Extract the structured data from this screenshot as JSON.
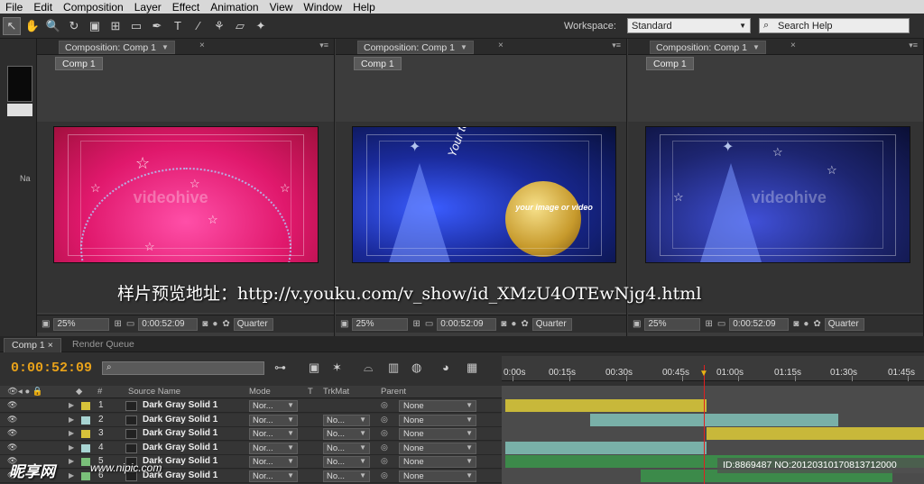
{
  "menu": [
    "File",
    "Edit",
    "Composition",
    "Layer",
    "Effect",
    "Animation",
    "View",
    "Window",
    "Help"
  ],
  "toolbar": {
    "workspace_label": "Workspace:",
    "workspace_value": "Standard",
    "search_help": "Search Help",
    "tools": [
      "selection-tool-icon",
      "hand-tool-icon",
      "zoom-tool-icon",
      "rotate-tool-icon",
      "camera-tool-icon",
      "pan-behind-icon",
      "rectangle-tool-icon",
      "pen-tool-icon",
      "type-tool-icon",
      "brush-tool-icon",
      "clone-stamp-icon",
      "eraser-icon",
      "puppet-pin-icon"
    ]
  },
  "panels": [
    {
      "tab": "Composition: Comp 1",
      "crumb": "Comp 1",
      "zoom": "25%",
      "timecode": "0:00:52:09",
      "quality": "Quarter"
    },
    {
      "tab": "Composition: Comp 1",
      "crumb": "Comp 1",
      "zoom": "25%",
      "timecode": "0:00:52:09",
      "quality": "Quarter"
    },
    {
      "tab": "Composition: Comp 1",
      "crumb": "Comp 1",
      "zoom": "25%",
      "timecode": "0:00:52:09",
      "quality": "Quarter"
    }
  ],
  "frames": {
    "watermark": "videohive",
    "vertical_text": "Your text here",
    "ornament_text": "your image or video"
  },
  "overlay_url": "样片预览地址：http://v.youku.com/v_show/id_XMzU4OTEwNjg4.html",
  "left_panel": {
    "label": "Na"
  },
  "timeline": {
    "tabs": [
      "Comp 1",
      "Render Queue"
    ],
    "timecode": "0:00:52:09",
    "ruler": [
      "0:00s",
      "00:15s",
      "00:30s",
      "00:45s",
      "01:00s",
      "01:15s",
      "01:30s",
      "01:45s"
    ],
    "columns": {
      "num": "#",
      "source": "Source Name",
      "mode": "Mode",
      "t": "T",
      "trkmat": "TrkMat",
      "parent": "Parent"
    },
    "layers": [
      {
        "num": "1",
        "name": "Dark Gray Solid 1",
        "mode": "Nor...",
        "trkmat": "",
        "parent": "None",
        "label_color": "#d6c23a",
        "bar_color": "#c8b83a"
      },
      {
        "num": "2",
        "name": "Dark Gray Solid 1",
        "mode": "Nor...",
        "trkmat": "No...",
        "parent": "None",
        "label_color": "#a8d4d2",
        "bar_color": "#79b0a8"
      },
      {
        "num": "3",
        "name": "Dark Gray Solid 1",
        "mode": "Nor...",
        "trkmat": "No...",
        "parent": "None",
        "label_color": "#d6c23a",
        "bar_color": "#c8b83a"
      },
      {
        "num": "4",
        "name": "Dark Gray Solid 1",
        "mode": "Nor...",
        "trkmat": "No...",
        "parent": "None",
        "label_color": "#a8d4d2",
        "bar_color": "#79b0a8"
      },
      {
        "num": "5",
        "name": "Dark Gray Solid 1",
        "mode": "Nor...",
        "trkmat": "No...",
        "parent": "None",
        "label_color": "#7ac07a",
        "bar_color": "#3c8a4a"
      },
      {
        "num": "6",
        "name": "Dark Gray Solid 1",
        "mode": "Nor...",
        "trkmat": "No...",
        "parent": "None",
        "label_color": "#7ac07a",
        "bar_color": "#3c8a4a"
      }
    ]
  },
  "watermarks": {
    "site": "昵享网",
    "url": "www.nipic.com",
    "id_strip": "ID:8869487 NO:20120310170813712000"
  }
}
